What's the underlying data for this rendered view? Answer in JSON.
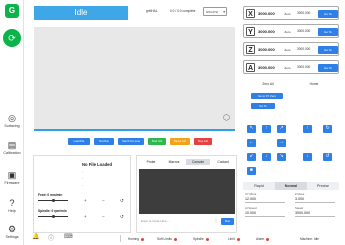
{
  "app": {
    "logo_glyph": "G",
    "connect_glyph": "⟳"
  },
  "sidebar": {
    "items": [
      {
        "label": "Surfacing",
        "icon": "surfacing-icon",
        "glyph": "◎"
      },
      {
        "label": "Calibration",
        "icon": "calibration-icon",
        "glyph": "▤"
      },
      {
        "label": "Firmware",
        "icon": "firmware-icon",
        "glyph": "▣"
      },
      {
        "label": "Help",
        "icon": "help-icon",
        "glyph": "?"
      },
      {
        "label": "Settings",
        "icon": "settings-icon",
        "glyph": "⚙"
      }
    ],
    "bottom_icons": [
      {
        "icon": "notification-bell-icon",
        "glyph": "🔔"
      },
      {
        "icon": "info-icon",
        "glyph": "ⓘ"
      },
      {
        "icon": "keyboard-icon",
        "glyph": "⌨"
      }
    ]
  },
  "topbar": {
    "state": "Idle",
    "left_text": "grblHAL",
    "mid_text": "0.0 / 0.0 complete",
    "select_value": "G54 (P1)"
  },
  "toolbar": {
    "buttons": [
      {
        "label": "Load File",
        "color": "#2e7fe6"
      },
      {
        "label": "Test Run",
        "color": "#2e7fe6"
      },
      {
        "label": "Start From Line",
        "color": "#2e7fe6"
      },
      {
        "label": "Start Job",
        "color": "#2db84d"
      },
      {
        "label": "Pause Job",
        "color": "#f2a31a"
      },
      {
        "label": "Stop Job",
        "color": "#e84040"
      }
    ]
  },
  "file_panel": {
    "title": "No File Loaded",
    "sub": [
      "-",
      "-",
      "-"
    ],
    "feed_label": "Feed: 0 mm/min",
    "spindle_label": "Spindle: 0 rpm/min",
    "feed_override": 0.5,
    "spindle_override": 0.5
  },
  "console": {
    "tabs": [
      "Probe",
      "Macros",
      "Console",
      "Coolant"
    ],
    "active_tab": "Console",
    "placeholder": "Enter G-Code Here...",
    "send_label": "Run"
  },
  "dro": {
    "axes": [
      {
        "letter": "X",
        "value": "3000.000",
        "zero": "Zero",
        "input": "3000.000",
        "goto": "Go To"
      },
      {
        "letter": "Y",
        "value": "3000.000",
        "zero": "Zero",
        "input": "3000.000",
        "goto": "Go To"
      },
      {
        "letter": "Z",
        "value": "3000.000",
        "zero": "Zero",
        "input": "3000.000",
        "goto": "Go To"
      },
      {
        "letter": "A",
        "value": "3000.000",
        "zero": "Zero",
        "input": "3000.000",
        "goto": "Go To"
      }
    ],
    "zero_all": "Zero All",
    "home": "Home",
    "goto_xy": "Go to XY Zero",
    "goto_z": "Go To"
  },
  "jog": {
    "modes": [
      "Rapid",
      "Normal",
      "Precise"
    ],
    "active_mode": "Normal",
    "xy_label": "XY Move",
    "xy_value": "12.000",
    "z_label": "Z Move",
    "z_value": "3.000",
    "at_label": "At Speed",
    "at_value": "10.000",
    "speed_label": "Speed",
    "speed_value": "3000.000"
  },
  "status": {
    "items": [
      "Homing",
      "Soft Limits",
      "Spindle",
      "Limit",
      "Alarm"
    ],
    "last_text": "Machine: Idle"
  }
}
